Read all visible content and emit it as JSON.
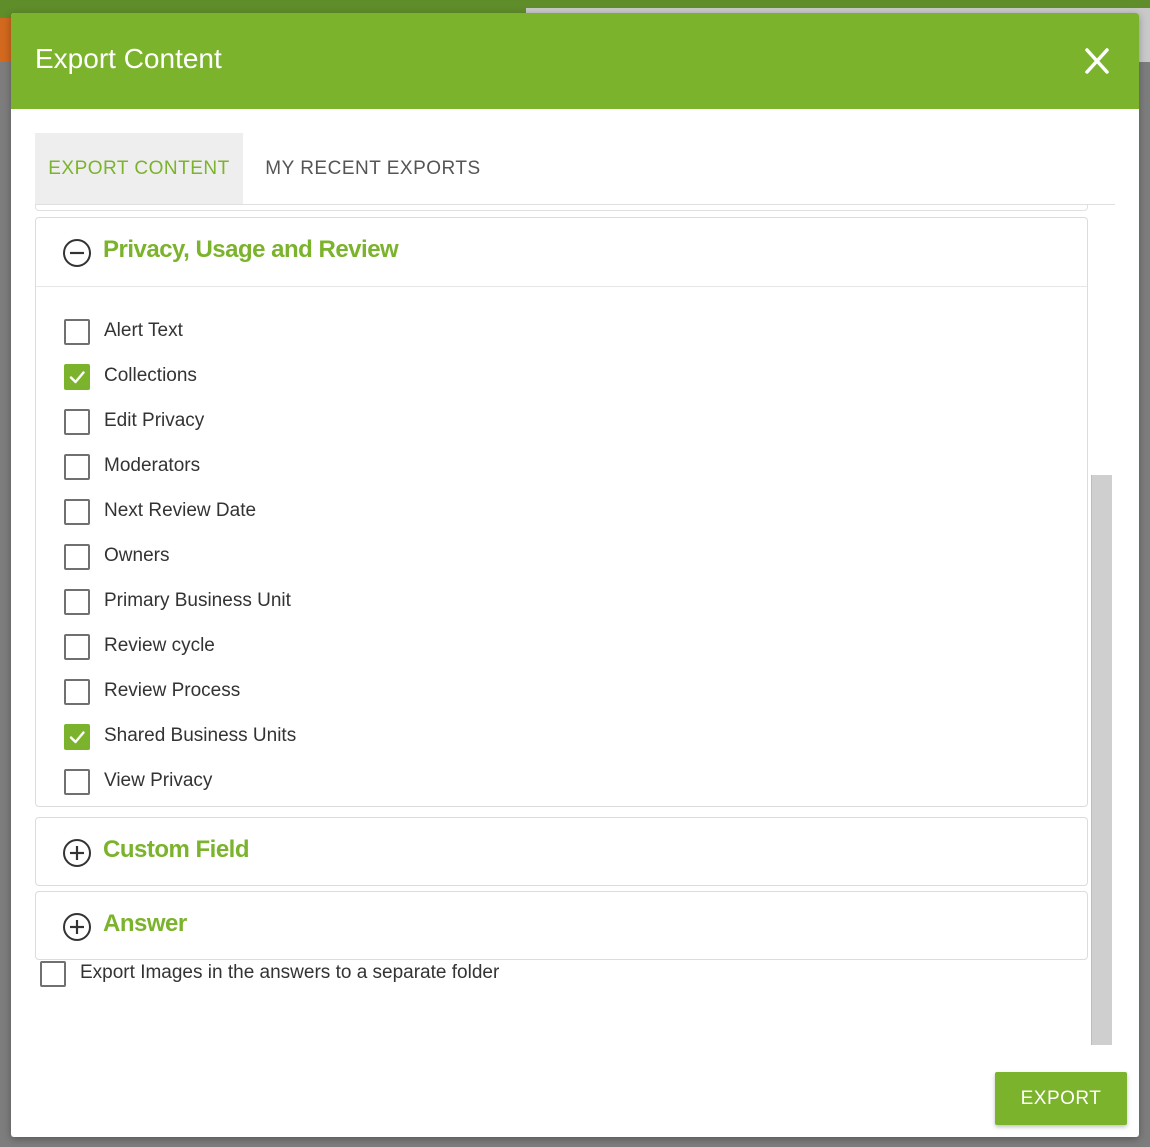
{
  "modal": {
    "title": "Export Content",
    "tabs": [
      {
        "label": "EXPORT CONTENT",
        "active": true
      },
      {
        "label": "MY RECENT EXPORTS",
        "active": false
      }
    ],
    "sections": [
      {
        "title": "Privacy, Usage and Review",
        "expanded": true,
        "toggle_icon": "minus-circle-icon",
        "options": [
          {
            "label": "Alert Text",
            "checked": false
          },
          {
            "label": "Collections",
            "checked": true
          },
          {
            "label": "Edit Privacy",
            "checked": false
          },
          {
            "label": "Moderators",
            "checked": false
          },
          {
            "label": "Next Review Date",
            "checked": false
          },
          {
            "label": "Owners",
            "checked": false
          },
          {
            "label": "Primary Business Unit",
            "checked": false
          },
          {
            "label": "Review cycle",
            "checked": false
          },
          {
            "label": "Review Process",
            "checked": false
          },
          {
            "label": "Shared Business Units",
            "checked": true
          },
          {
            "label": "View Privacy",
            "checked": false
          }
        ]
      },
      {
        "title": "Custom Field",
        "expanded": false,
        "toggle_icon": "plus-circle-icon"
      },
      {
        "title": "Answer",
        "expanded": false,
        "toggle_icon": "plus-circle-icon"
      }
    ],
    "export_images_option": {
      "label": "Export Images in the answers to a separate folder",
      "checked": false
    },
    "export_button": "EXPORT"
  },
  "colors": {
    "accent": "#7cb32d",
    "header_bg": "#7cb32d",
    "checkbox_border": "#707070",
    "text": "#333333"
  }
}
